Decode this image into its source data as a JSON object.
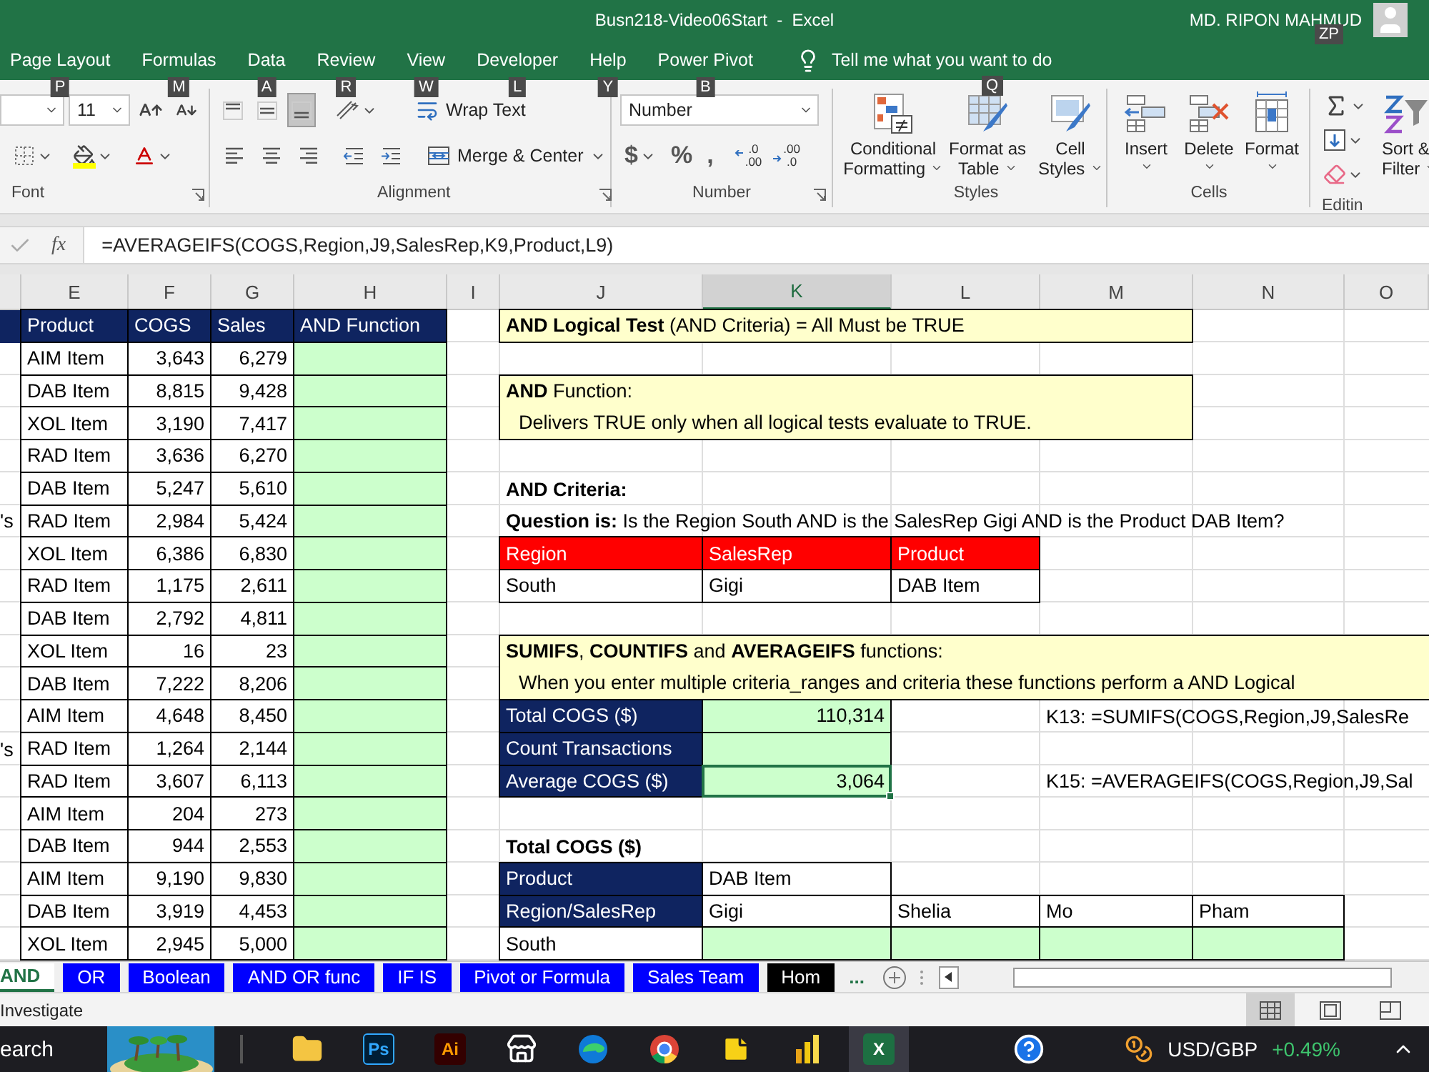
{
  "window": {
    "title": "Busn218-Video06Start  -  Excel",
    "user": "MD. RIPON MAHMUD",
    "user_keytip": "ZP"
  },
  "ribbon_tabs": [
    {
      "label": "Page Layout",
      "keytip": "P"
    },
    {
      "label": "Formulas",
      "keytip": "M"
    },
    {
      "label": "Data",
      "keytip": "A"
    },
    {
      "label": "Review",
      "keytip": "R"
    },
    {
      "label": "View",
      "keytip": "W"
    },
    {
      "label": "Developer",
      "keytip": "L"
    },
    {
      "label": "Help",
      "keytip": "Y"
    },
    {
      "label": "Power Pivot",
      "keytip": "B"
    }
  ],
  "tell_me": {
    "placeholder": "Tell me what you want to do",
    "keytip": "Q"
  },
  "ribbon": {
    "font": {
      "size": "11",
      "label": "Font"
    },
    "alignment": {
      "vertical_align": [
        {
          "kind": "top",
          "selected": false
        },
        {
          "kind": "middle",
          "selected": false
        },
        {
          "kind": "bottom",
          "selected": true
        }
      ],
      "wrap": "Wrap Text",
      "merge": "Merge & Center",
      "label": "Alignment"
    },
    "number": {
      "format": "Number",
      "currency": "$",
      "percent": "%",
      "comma": ",",
      "increase_decimal": [
        ".0",
        ".00"
      ],
      "decrease_decimal": [
        ".00",
        ".0"
      ],
      "label": "Number"
    },
    "styles": {
      "buttons": [
        {
          "kind": "conditional",
          "label": "Conditional Formatting"
        },
        {
          "kind": "table",
          "label": "Format as Table"
        },
        {
          "kind": "cell",
          "label": "Cell Styles"
        }
      ],
      "label": "Styles"
    },
    "cells": {
      "buttons": [
        {
          "kind": "insert",
          "label": "Insert"
        },
        {
          "kind": "delete",
          "label": "Delete"
        },
        {
          "kind": "format",
          "label": "Format"
        }
      ],
      "label": "Cells"
    },
    "editing": {
      "sort": "Sort & Filter",
      "label": "Editin"
    }
  },
  "formula_bar": {
    "fx": "fx",
    "formula": "=AVERAGEIFS(COGS,Region,J9,SalesRep,K9,Product,L9)"
  },
  "columns": [
    {
      "letter": "E",
      "selected": false
    },
    {
      "letter": "F",
      "selected": false
    },
    {
      "letter": "G",
      "selected": false
    },
    {
      "letter": "H",
      "selected": false
    },
    {
      "letter": "I",
      "selected": false
    },
    {
      "letter": "J",
      "selected": false
    },
    {
      "letter": "K",
      "selected": true
    },
    {
      "letter": "L",
      "selected": false
    },
    {
      "letter": "M",
      "selected": false
    },
    {
      "letter": "N",
      "selected": false
    },
    {
      "letter": "O",
      "selected": false
    }
  ],
  "data_table": {
    "headers": [
      "Product",
      "COGS",
      "Sales",
      "AND Function"
    ],
    "rows": [
      {
        "product": "AIM Item",
        "cogs": "3,643",
        "sales": "6,279"
      },
      {
        "product": "DAB Item",
        "cogs": "8,815",
        "sales": "9,428"
      },
      {
        "product": "XOL Item",
        "cogs": "3,190",
        "sales": "7,417"
      },
      {
        "product": "RAD Item",
        "cogs": "3,636",
        "sales": "6,270"
      },
      {
        "product": "DAB Item",
        "cogs": "5,247",
        "sales": "5,610"
      },
      {
        "column_d": "'s",
        "product": "RAD Item",
        "cogs": "2,984",
        "sales": "5,424"
      },
      {
        "product": "XOL Item",
        "cogs": "6,386",
        "sales": "6,830"
      },
      {
        "product": "RAD Item",
        "cogs": "1,175",
        "sales": "2,611"
      },
      {
        "product": "DAB Item",
        "cogs": "2,792",
        "sales": "4,811"
      },
      {
        "product": "XOL Item",
        "cogs": "16",
        "sales": "23"
      },
      {
        "product": "DAB Item",
        "cogs": "7,222",
        "sales": "8,206"
      },
      {
        "product": "AIM Item",
        "cogs": "4,648",
        "sales": "8,450"
      },
      {
        "column_d": "'s",
        "product": "RAD Item",
        "cogs": "1,264",
        "sales": "2,144"
      },
      {
        "product": "RAD Item",
        "cogs": "3,607",
        "sales": "6,113"
      },
      {
        "product": "AIM Item",
        "cogs": "204",
        "sales": "273"
      },
      {
        "product": "DAB Item",
        "cogs": "944",
        "sales": "2,553"
      },
      {
        "product": "AIM Item",
        "cogs": "9,190",
        "sales": "9,830"
      },
      {
        "product": "DAB Item",
        "cogs": "3,919",
        "sales": "4,453"
      },
      {
        "product": "XOL Item",
        "cogs": "2,945",
        "sales": "5,000"
      }
    ]
  },
  "panel": {
    "title": "**AND Logical Test** (AND Criteria) = All Must be TRUE",
    "function_box": {
      "heading": "**AND** Function:",
      "text": "Delivers TRUE only when all logical tests evaluate to TRUE."
    },
    "criteria": {
      "heading": "AND Criteria:",
      "question": "**Question is:** Is the Region South AND is the SalesRep Gigi AND is the Product DAB Item?",
      "headers": [
        "Region",
        "SalesRep",
        "Product"
      ],
      "values": [
        "South",
        "Gigi",
        "DAB Item"
      ]
    },
    "functions_box": {
      "heading": "**SUMIFS**, **COUNTIFS** and **AVERAGEIFS** functions:",
      "text": "When you enter multiple criteria_ranges and criteria these functions perform a AND Logical"
    },
    "results": [
      {
        "label": "Total COGS ($)",
        "value": "110,314",
        "note": "K13: =SUMIFS(COGS,Region,J9,SalesRe",
        "selected": false
      },
      {
        "label": "Count Transactions",
        "selected": false
      },
      {
        "label": "Average COGS ($)",
        "value": "3,064",
        "note": "K15: =AVERAGEIFS(COGS,Region,J9,Sal",
        "selected": true
      }
    ],
    "cross_tab": {
      "title": "Total COGS ($)",
      "product_label": "Product",
      "product": "DAB Item",
      "row_header": "Region/SalesRep",
      "reps": [
        "Gigi",
        "Shelia",
        "Mo",
        "Pham"
      ],
      "regions": [
        "South"
      ]
    }
  },
  "sheet_tabs": [
    {
      "label": "AND",
      "selected": true
    },
    {
      "label": "OR",
      "selected": false,
      "color": "#0000ff"
    },
    {
      "label": "Boolean",
      "selected": false,
      "color": "#0000ff"
    },
    {
      "label": "AND OR func",
      "selected": false,
      "color": "#0000ff"
    },
    {
      "label": "IF IS",
      "selected": false,
      "color": "#0000ff"
    },
    {
      "label": "Pivot or Formula",
      "selected": false,
      "color": "#0000ff"
    },
    {
      "label": "Sales Team",
      "selected": false,
      "color": "#0000ff"
    },
    {
      "label": "Hom",
      "selected": false,
      "color": "#000000"
    }
  ],
  "more_tabs": "...",
  "status_bar": {
    "mode": "Investigate",
    "views": [
      {
        "kind": "normal",
        "selected": true
      },
      {
        "kind": "page_layout",
        "selected": false
      },
      {
        "kind": "page_break",
        "selected": false
      }
    ]
  },
  "taskbar": {
    "search": "earch",
    "apps": [
      {
        "kind": "explorer",
        "selected": false
      },
      {
        "kind": "photoshop",
        "label": "Ps",
        "selected": false
      },
      {
        "kind": "illustrator",
        "label": "Ai",
        "selected": false
      },
      {
        "kind": "store",
        "selected": false
      },
      {
        "kind": "edge",
        "selected": false
      },
      {
        "kind": "chrome",
        "selected": false
      },
      {
        "kind": "notes",
        "selected": false
      },
      {
        "kind": "powerbi",
        "selected": false
      },
      {
        "kind": "excel",
        "label": "X",
        "selected": true
      }
    ],
    "ticker": {
      "symbol": "USD/GBP",
      "change": "+0.49%"
    }
  }
}
